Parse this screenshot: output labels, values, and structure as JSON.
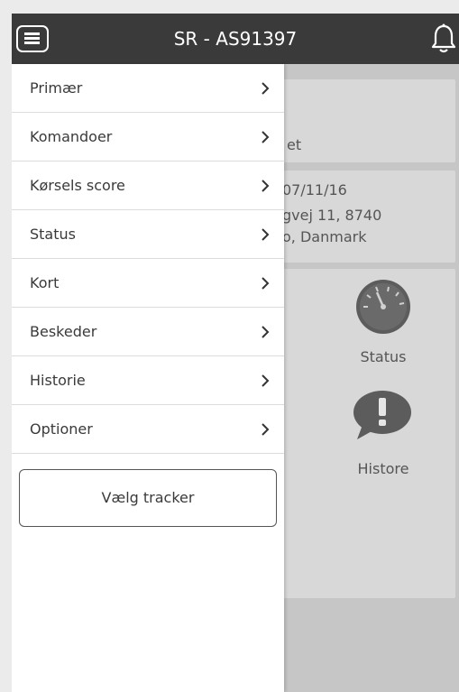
{
  "header": {
    "title": "SR - AS91397"
  },
  "background": {
    "card1_text": "et",
    "card2_line1": "07/11/16",
    "card2_line2": "gvej 11, 8740",
    "card2_line3": "o, Danmark",
    "status_label": "Status",
    "history_label": "Histore"
  },
  "drawer": {
    "items": [
      {
        "label": "Primær"
      },
      {
        "label": "Komandoer"
      },
      {
        "label": "Kørsels score"
      },
      {
        "label": "Status"
      },
      {
        "label": "Kort"
      },
      {
        "label": "Beskeder"
      },
      {
        "label": "Historie"
      },
      {
        "label": "Optioner"
      }
    ],
    "tracker_button": "Vælg tracker"
  },
  "colors": {
    "header_bg": "#3a3a3a",
    "drawer_bg": "#ffffff",
    "background_overlay": "#c6c6c6"
  }
}
